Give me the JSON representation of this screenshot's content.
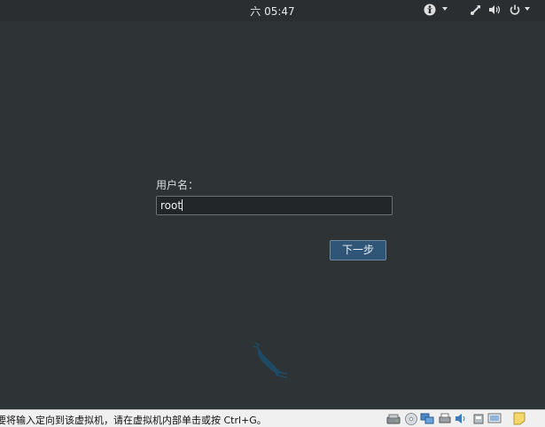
{
  "topbar": {
    "clock": "六 05:47",
    "icons": [
      "accessibility-icon",
      "network-icon",
      "volume-icon",
      "power-icon"
    ]
  },
  "login": {
    "label": "用户名：",
    "username_value": "root",
    "next_button": "下一步"
  },
  "statusbar": {
    "hint": "要将输入定向到该虚拟机，请在虚拟机内部单击或按 Ctrl+G。",
    "icons": [
      "hard-disk-icon",
      "cd-drive-icon",
      "network-adapter-icon",
      "printer-icon",
      "sound-icon",
      "usb-icon",
      "display-icon",
      "message-icon"
    ]
  },
  "colors": {
    "desktop": "#2e3336",
    "button": "#2f5577"
  }
}
